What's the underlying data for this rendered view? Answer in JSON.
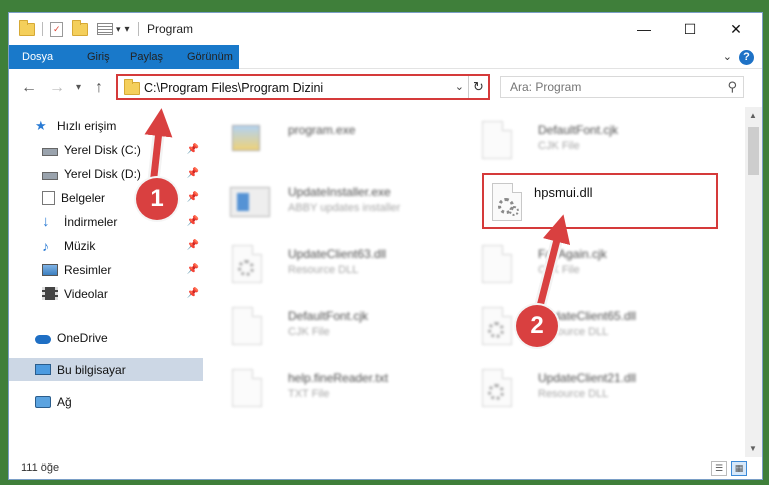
{
  "window": {
    "title": "Program",
    "controls": {
      "minimize": "—",
      "maximize": "☐",
      "close": "✕"
    }
  },
  "ribbon": {
    "tabs": [
      "Dosya",
      "Giriş",
      "Paylaş",
      "Görünüm"
    ],
    "help": "?"
  },
  "nav": {
    "back": "←",
    "forward": "→",
    "recent": "▾",
    "up": "↑",
    "address": "C:\\Program Files\\Program Dizini",
    "refresh": "↻",
    "search_placeholder": "Ara: Program"
  },
  "sidebar": {
    "items": [
      {
        "label": "Hızlı erişim",
        "icon": "star-icon"
      },
      {
        "label": "Yerel Disk (C:)",
        "icon": "drive-icon"
      },
      {
        "label": "Yerel Disk (D:)",
        "icon": "drive-icon"
      },
      {
        "label": "Belgeler",
        "icon": "document-icon"
      },
      {
        "label": "İndirmeler",
        "icon": "download-icon"
      },
      {
        "label": "Müzik",
        "icon": "music-icon"
      },
      {
        "label": "Resimler",
        "icon": "picture-icon"
      },
      {
        "label": "Videolar",
        "icon": "video-icon"
      },
      {
        "label": "OneDrive",
        "icon": "cloud-icon"
      },
      {
        "label": "Bu bilgisayar",
        "icon": "computer-icon"
      },
      {
        "label": "Ağ",
        "icon": "network-icon"
      }
    ]
  },
  "files": [
    {
      "name": "program.exe",
      "type": ""
    },
    {
      "name": "DefaultFont.cjk",
      "type": "CJK File"
    },
    {
      "name": "UpdateInstaller.exe",
      "type": "ABBY updates installer"
    },
    {
      "name": "hpsmui.dll",
      "type": ""
    },
    {
      "name": "UpdateClient63.dll",
      "type": "Resource DLL"
    },
    {
      "name": "FaxAgain.cjk",
      "type": "CJK File"
    },
    {
      "name": "DefaultFont.cjk",
      "type": "CJK File"
    },
    {
      "name": "UpdateClient65.dll",
      "type": "Resource DLL"
    },
    {
      "name": "help.fineReader.txt",
      "type": "TXT File"
    },
    {
      "name": "UpdateClient21.dll",
      "type": "Resource DLL"
    }
  ],
  "status": {
    "count": "111 öğe"
  },
  "annotations": {
    "step1": "1",
    "step2": "2"
  },
  "colors": {
    "accent": "#1979ca",
    "highlight": "#d53a3a",
    "selection": "#ccd7e5"
  }
}
